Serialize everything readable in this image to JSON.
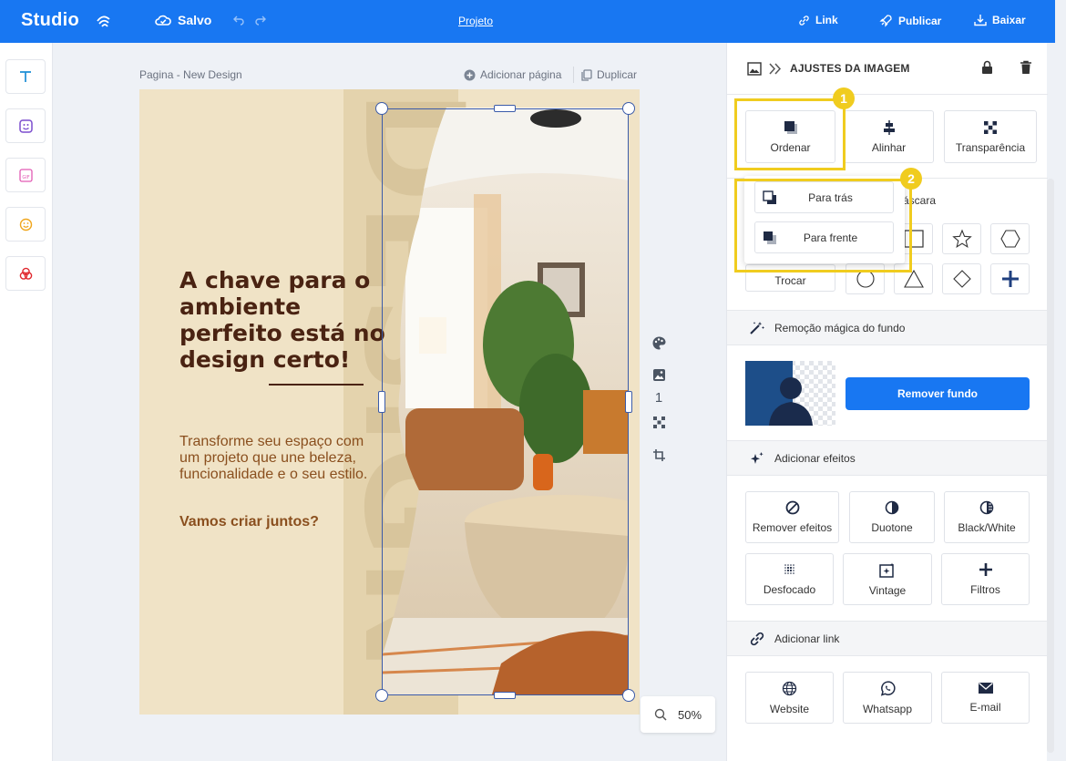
{
  "topbar": {
    "logo": "Studio",
    "saved_label": "Salvo",
    "project_label": "Projeto",
    "link_label": "Link",
    "publish_label": "Publicar",
    "download_label": "Baixar"
  },
  "canvas": {
    "page_label": "Pagina - New Design",
    "add_page_label": "Adicionar página",
    "duplicate_label": "Duplicar",
    "headline": "A chave para o ambiente perfeito está no design certo!",
    "body": "Transforme seu espaço com um projeto que une beleza, funcionalidade e o seu estilo.",
    "cta": "Vamos criar juntos?",
    "background_word": "DESIGN",
    "page_number": "1",
    "zoom": "50%"
  },
  "panel": {
    "title": "AJUSTES DA IMAGEM",
    "order_label": "Ordenar",
    "align_label": "Alinhar",
    "transparency_label": "Transparência",
    "mask_label": "áscara",
    "swap_label": "Trocar",
    "order_menu": {
      "back_label": "Para trás",
      "front_label": "Para frente"
    },
    "magic_section": "Remoção mágica do fundo",
    "remove_bg_label": "Remover fundo",
    "effects_section": "Adicionar efeitos",
    "effects": {
      "remove": "Remover efeitos",
      "duotone": "Duotone",
      "bw": "Black/White",
      "blur": "Desfocado",
      "vintage": "Vintage",
      "filters": "Filtros"
    },
    "link_section": "Adicionar link",
    "links": {
      "website": "Website",
      "whatsapp": "Whatsapp",
      "email": "E-mail"
    }
  },
  "highlights": {
    "first": "1",
    "second": "2"
  },
  "colors": {
    "brand_blue": "#1877f2",
    "highlight_yellow": "#f0cc1f",
    "design_bg": "#f0e3c6",
    "headline_brown": "#4a2312",
    "body_brown": "#8a4f1e"
  }
}
